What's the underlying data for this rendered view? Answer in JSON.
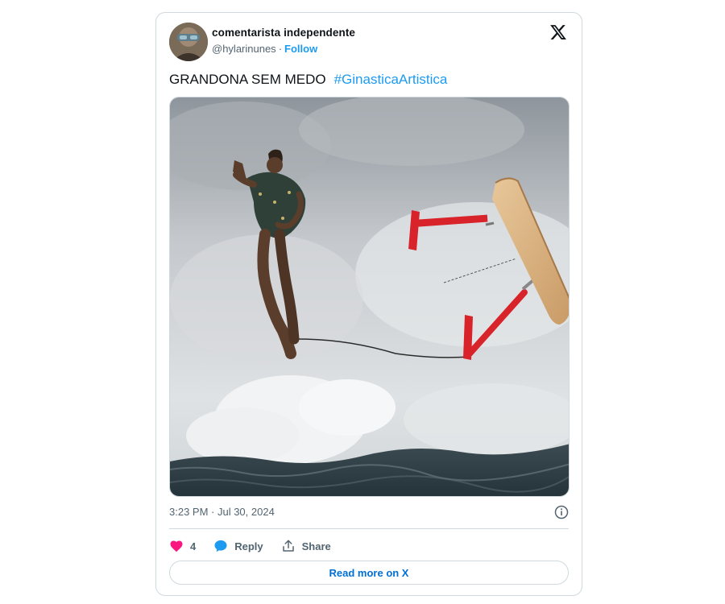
{
  "author": {
    "name": "comentarista independente",
    "handle": "@hylarinunes",
    "separator": "·",
    "follow_label": "Follow"
  },
  "tweet": {
    "text": "GRANDONA SEM MEDO",
    "hashtag": "#GinasticaArtistica",
    "timestamp": "3:23 PM · Jul 30, 2024"
  },
  "actions": {
    "like_count": "4",
    "reply_label": "Reply",
    "share_label": "Share"
  },
  "read_more_label": "Read more on X",
  "icons": {
    "logo": "x-logo-icon",
    "info": "info-icon",
    "like": "heart-icon",
    "reply": "speech-bubble-icon",
    "share": "share-icon"
  },
  "colors": {
    "accent": "#1d9bf0",
    "like": "#f91880",
    "text_secondary": "#536471",
    "border": "#cfd9de"
  }
}
